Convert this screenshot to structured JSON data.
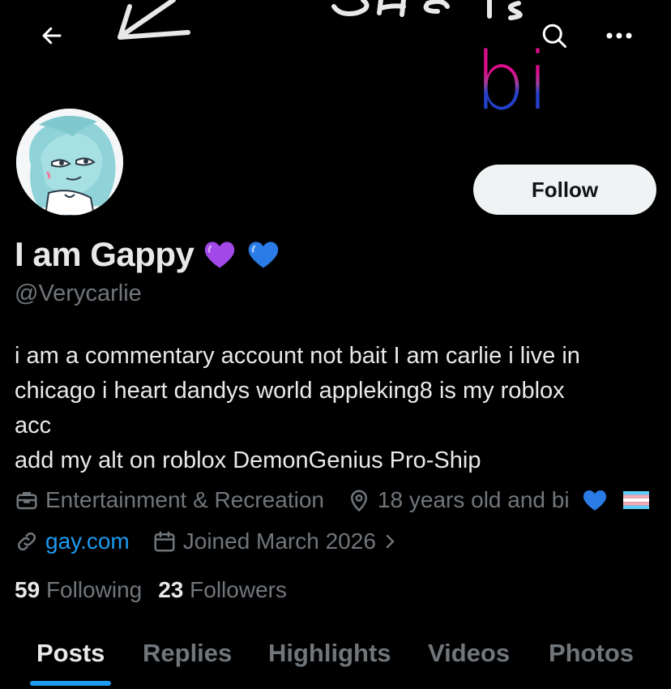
{
  "header": {
    "back_icon": "arrow-left-icon",
    "search_icon": "search-icon",
    "more_icon": "more-dots-icon",
    "overlay_text": "bi"
  },
  "profile": {
    "name": "I am Gappy",
    "name_emojis": [
      "purple-heart",
      "blue-heart"
    ],
    "handle": "@Verycarlie",
    "follow_label": "Follow",
    "bio": "i am a commentary account not bait I am carlie i live in\nchicago i heart dandys world appleking8 is my roblox\nacc\nadd my alt on roblox DemonGenius Pro-Ship",
    "category": "Entertainment & Recreation",
    "location": "18 years old and bi",
    "website": "gay.com",
    "joined": "Joined March 2026",
    "following_count": "59",
    "following_label": "Following",
    "followers_count": "23",
    "followers_label": "Followers"
  },
  "tabs": [
    {
      "label": "Posts",
      "active": true
    },
    {
      "label": "Replies",
      "active": false
    },
    {
      "label": "Highlights",
      "active": false
    },
    {
      "label": "Videos",
      "active": false
    },
    {
      "label": "Photos",
      "active": false
    }
  ],
  "colors": {
    "background": "#000000",
    "text": "#e7e9ea",
    "muted": "#71767b",
    "accent": "#1d9bf0",
    "follow_bg": "#eff3f4"
  }
}
